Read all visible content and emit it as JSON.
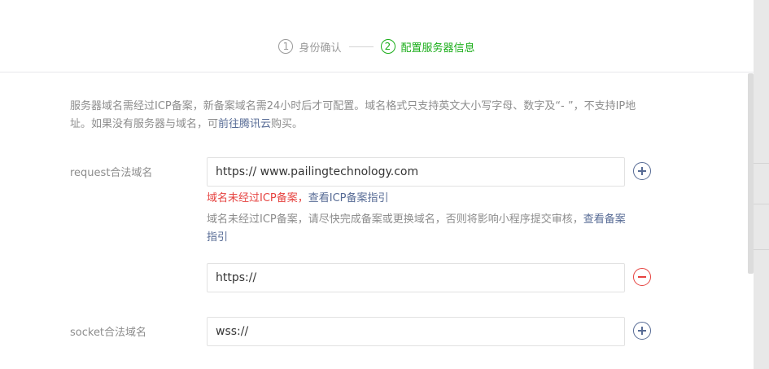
{
  "steps": [
    {
      "num": "1",
      "label": "身份确认",
      "active": false
    },
    {
      "num": "2",
      "label": "配置服务器信息",
      "active": true
    }
  ],
  "notice": {
    "text_before": "服务器域名需经过ICP备案，新备案域名需24小时后才可配置。域名格式只支持英文大小写字母、数字及“- ”，不支持IP地址。如果没有服务器与域名，可",
    "link": "前往腾讯云",
    "text_after": "购买。"
  },
  "request": {
    "label": "request合法域名",
    "input1_value": "https:// www.pailingtechnology.com",
    "error_text": "域名未经过ICP备案，",
    "error_link": "查看ICP备案指引",
    "hint_text": "域名未经过ICP备案，请尽快完成备案或更换域名，否则将影响小程序提交审核，",
    "hint_link": "查看备案指引",
    "input2_value": "https://"
  },
  "socket": {
    "label": "socket合法域名",
    "input_value": "wss://"
  },
  "colors": {
    "accent_green": "#1aad19",
    "link_blue": "#576b95",
    "error_red": "#e64340",
    "muted_text": "#8d8d8d"
  }
}
